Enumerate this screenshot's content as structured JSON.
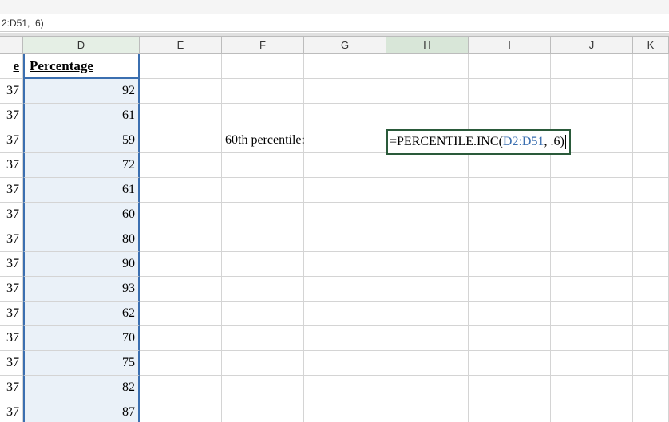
{
  "formula_bar": "2:D51, .6)",
  "columns": {
    "C_partial": "",
    "D": "D",
    "E": "E",
    "F": "F",
    "G": "G",
    "H": "H",
    "I": "I",
    "J": "J",
    "K": "K"
  },
  "header_row": {
    "C_partial": "e",
    "D": "Percentage"
  },
  "data_rows": [
    {
      "C_partial": "37",
      "D": "92"
    },
    {
      "C_partial": "37",
      "D": "61"
    },
    {
      "C_partial": "37",
      "D": "59"
    },
    {
      "C_partial": "37",
      "D": "72"
    },
    {
      "C_partial": "37",
      "D": "61"
    },
    {
      "C_partial": "37",
      "D": "60"
    },
    {
      "C_partial": "37",
      "D": "80"
    },
    {
      "C_partial": "37",
      "D": "90"
    },
    {
      "C_partial": "37",
      "D": "93"
    },
    {
      "C_partial": "37",
      "D": "62"
    },
    {
      "C_partial": "37",
      "D": "70"
    },
    {
      "C_partial": "37",
      "D": "75"
    },
    {
      "C_partial": "37",
      "D": "82"
    },
    {
      "C_partial": "37",
      "D": "87"
    }
  ],
  "label": "60th percentile:",
  "formula": {
    "prefix": "=PERCENTILE.INC(",
    "ref": "D2:D51",
    "suffix": ", .6)"
  }
}
